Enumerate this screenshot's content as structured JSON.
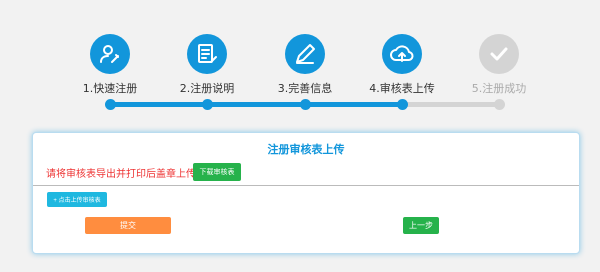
{
  "steps": [
    {
      "label": "1.快速注册",
      "icon": "user-edit-icon",
      "active": true
    },
    {
      "label": "2.注册说明",
      "icon": "document-edit-icon",
      "active": true
    },
    {
      "label": "3.完善信息",
      "icon": "pencil-icon",
      "active": true
    },
    {
      "label": "4.审核表上传",
      "icon": "cloud-upload-icon",
      "active": true
    },
    {
      "label": "5.注册成功",
      "icon": "checkmark-icon",
      "active": false
    }
  ],
  "colors": {
    "accent": "#1296db",
    "inactive": "#d4d4d4",
    "success": "#26b24b",
    "warning": "#e33333",
    "orange": "#ff8d3f",
    "cyan": "#1fb8e0"
  },
  "card": {
    "title": "注册审核表上传",
    "instruction": "请将审核表导出并打印后盖章上传",
    "download_button": "下载审核表",
    "upload_button": "+ 点击上传审核表",
    "submit_button": "提交",
    "prev_button": "上一步"
  }
}
